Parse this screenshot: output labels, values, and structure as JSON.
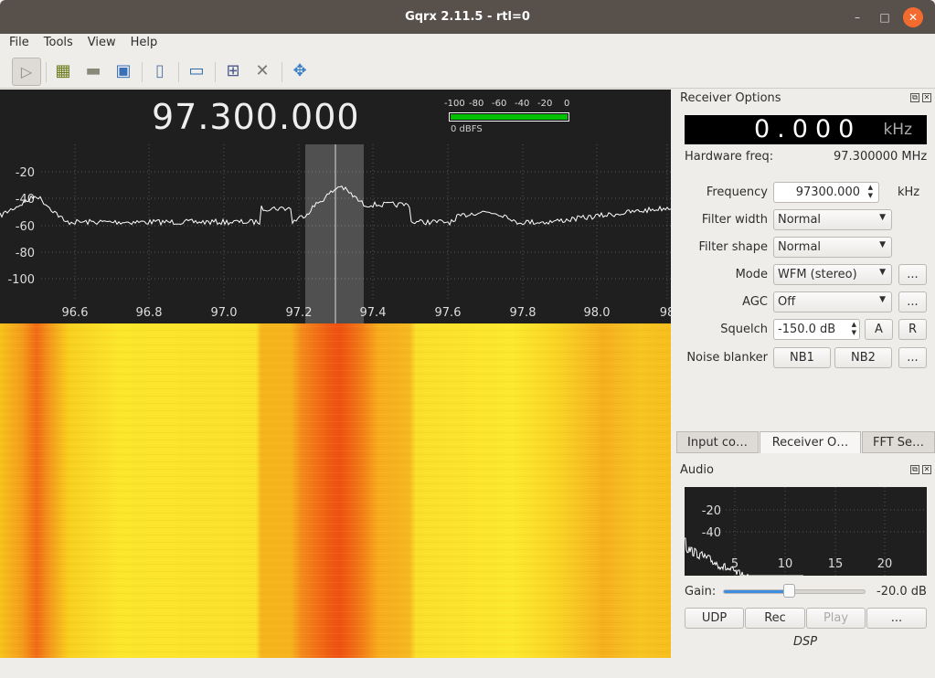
{
  "window": {
    "title": "Gqrx 2.11.5 - rtl=0",
    "minimize": "–",
    "maximize": "□",
    "close": "✕"
  },
  "menu": [
    "File",
    "Tools",
    "View",
    "Help"
  ],
  "toolbar": {
    "icons": [
      "play-icon",
      "hardware-icon",
      "open-folder-icon",
      "save-icon",
      "bookmark-icon",
      "monitor-icon",
      "network-icon",
      "tools-icon",
      "fullscreen-icon"
    ]
  },
  "spectrum": {
    "frequency": "97.300.000",
    "meter_ticks": [
      "-100",
      "-80",
      "-60",
      "-40",
      "-20",
      "0"
    ],
    "meter_level_dbfs": 0,
    "meter_label": "0 dBFS",
    "y_ticks": [
      "-20",
      "-40",
      "-60",
      "-80",
      "-100"
    ],
    "x_ticks": [
      "96.6",
      "96.8",
      "97.0",
      "97.2",
      "97.4",
      "97.6",
      "97.8",
      "98.0",
      "98"
    ]
  },
  "receiver": {
    "title": "Receiver Options",
    "offset": "0.000",
    "offset_unit": "kHz",
    "hw_label": "Hardware freq:",
    "hw_value": "97.300000 MHz",
    "frequency_label": "Frequency",
    "frequency_value": "97300.000",
    "frequency_unit": "kHz",
    "filter_width_label": "Filter width",
    "filter_width": "Normal",
    "filter_shape_label": "Filter shape",
    "filter_shape": "Normal",
    "mode_label": "Mode",
    "mode": "WFM (stereo)",
    "agc_label": "AGC",
    "agc": "Off",
    "squelch_label": "Squelch",
    "squelch": "-150.0 dB",
    "squelch_a": "A",
    "squelch_r": "R",
    "nb_label": "Noise blanker",
    "nb1": "NB1",
    "nb2": "NB2",
    "more": "..."
  },
  "tabs": [
    {
      "label": "Input co…"
    },
    {
      "label": "Receiver O…",
      "active": true
    },
    {
      "label": "FFT Se…"
    }
  ],
  "audio": {
    "title": "Audio",
    "y_ticks": [
      "-20",
      "-40"
    ],
    "x_ticks": [
      "5",
      "10",
      "15",
      "20"
    ],
    "gain_label": "Gain:",
    "gain_value": "-20.0 dB",
    "gain_fraction": 0.46,
    "buttons": [
      "UDP",
      "Rec",
      "Play",
      "..."
    ],
    "dsp": "DSP"
  },
  "colors": {
    "accent": "#3d8ee0",
    "meter": "#00c000",
    "close": "#f46b2f"
  }
}
